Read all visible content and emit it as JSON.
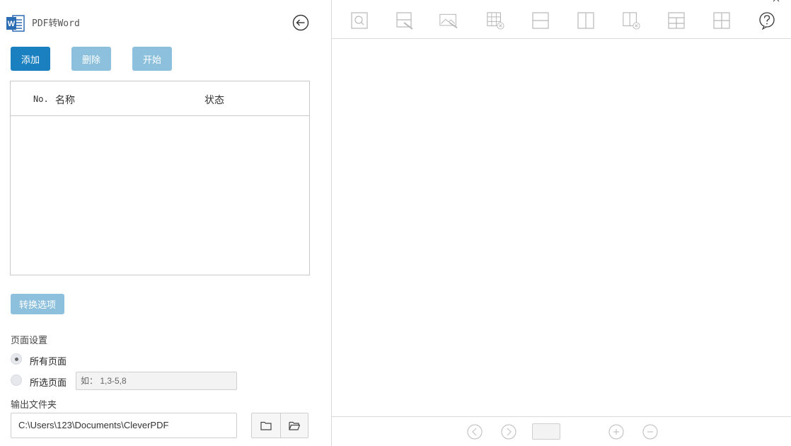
{
  "app": {
    "title": "PDF转Word"
  },
  "actions": {
    "add_label": "添加",
    "delete_label": "删除",
    "start_label": "开始"
  },
  "file_table": {
    "columns": {
      "no": "No.",
      "name": "名称",
      "status": "状态"
    },
    "rows": []
  },
  "options": {
    "convert_options_label": "转换选项",
    "page_settings_label": "页面设置",
    "all_pages_label": "所有页面",
    "selected_pages_label": "所选页面",
    "selected_pages_placeholder": "如： 1,3-5,8",
    "page_mode": "all"
  },
  "output": {
    "label": "输出文件夹",
    "path": "C:\\Users\\123\\Documents\\CleverPDF"
  },
  "toolbar": {
    "tools": [
      "search-icon",
      "select-region-icon",
      "select-image-icon",
      "delete-table-icon",
      "horizontal-line-icon",
      "vertical-line-icon",
      "delete-column-icon",
      "add-row-icon",
      "table-grid-icon",
      "help-icon"
    ]
  },
  "colors": {
    "primary": "#1b80c0",
    "disabled": "#8cc0dd",
    "border": "#d9d9d9"
  }
}
